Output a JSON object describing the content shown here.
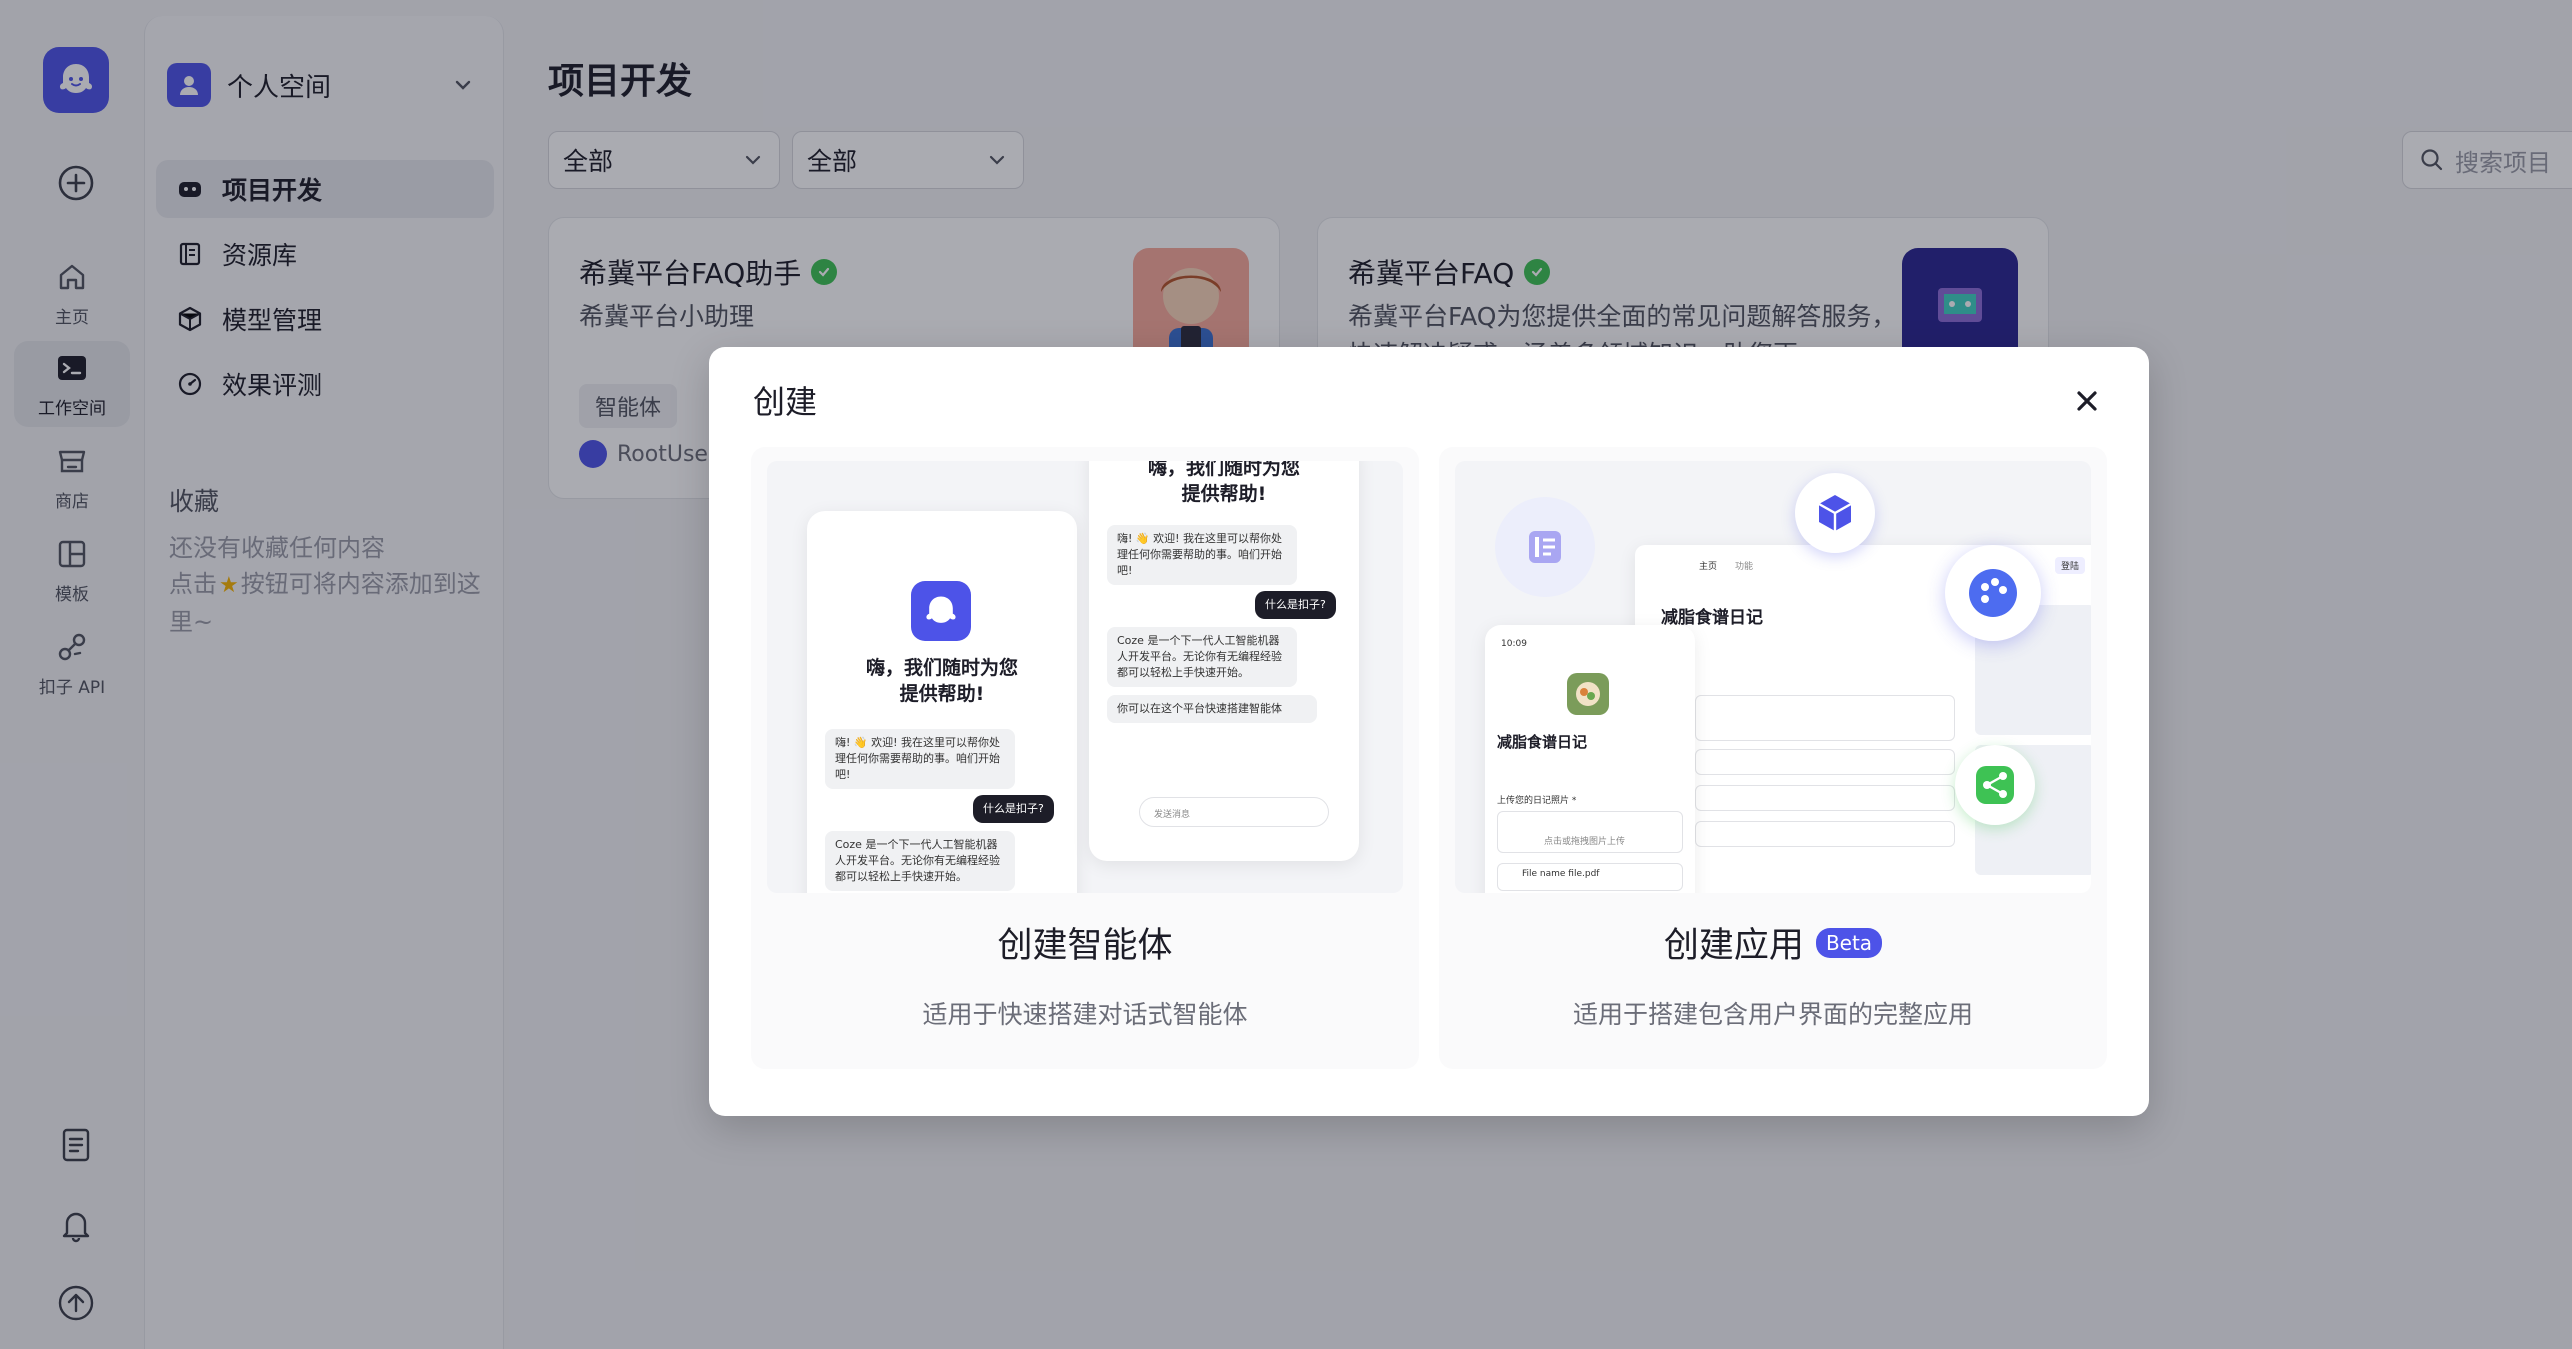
{
  "rail": {
    "items": [
      {
        "label": "主页",
        "icon": "home-icon"
      },
      {
        "label": "工作空间",
        "icon": "terminal-icon",
        "active": true
      },
      {
        "label": "商店",
        "icon": "store-icon"
      },
      {
        "label": "模板",
        "icon": "template-icon"
      },
      {
        "label": "扣子 API",
        "icon": "api-icon"
      }
    ]
  },
  "sidebar": {
    "workspace": "个人空间",
    "nav": [
      "项目开发",
      "资源库",
      "模型管理",
      "效果评测"
    ],
    "favorites_title": "收藏",
    "favorites_empty": "还没有收藏任何内容",
    "favorites_hint_prefix": "点击",
    "favorites_hint_suffix": "按钮可将内容添加到这里~"
  },
  "main": {
    "title": "项目开发",
    "filter1": "全部",
    "filter2": "全部",
    "search_placeholder": "搜索项目",
    "cards": [
      {
        "title": "希冀平台FAQ助手",
        "desc": "希冀平台小助理",
        "tag": "智能体",
        "owner": "RootUser"
      },
      {
        "title": "希冀平台FAQ",
        "desc": "希冀平台FAQ为您提供全面的常见问题解答服务，快速解决疑惑，涵盖多领域知识，助您更"
      }
    ]
  },
  "modal": {
    "title": "创建",
    "options": [
      {
        "title": "创建智能体",
        "desc": "适用于快速搭建对话式智能体",
        "illus": {
          "greeting": "嗨，我们随时为您提供帮助!",
          "greeting_top": "嗨，我们随时为您提供帮助!",
          "bubble_welcome": "嗨! 👋 欢迎! 我在这里可以帮你处理任何你需要帮助的事。咱们开始吧!",
          "bubble_question": "什么是扣子?",
          "bubble_answer": "Coze 是一个下一代人工智能机器人开发平台。无论你有无编程经验都可以轻松上手快速开始。",
          "bubble_tip": "你可以在这个平台快速搭建智能体",
          "input_placeholder": "发送消息"
        }
      },
      {
        "title": "创建应用",
        "badge": "Beta",
        "desc": "适用于搭建包含用户界面的完整应用",
        "illus": {
          "app_name": "减脂食谱日记",
          "tab_home": "主页",
          "tab_func": "功能",
          "login": "登陆",
          "time": "10:09",
          "upload_label": "上传您的日记照片 *",
          "upload_hint": "点击或拖拽图片上传",
          "file_name": "File name file.pdf"
        }
      }
    ]
  }
}
